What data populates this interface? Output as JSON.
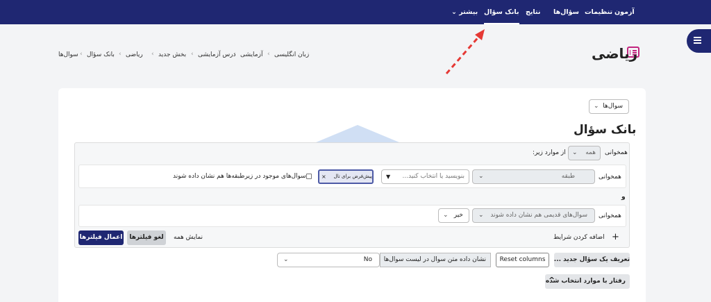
{
  "navbar": {
    "items": [
      {
        "label": "آزمون"
      },
      {
        "label": "تنظیمات"
      },
      {
        "label": "سؤال‌ها"
      },
      {
        "label": "نتایج"
      },
      {
        "label": "بانک سؤال",
        "active": true
      },
      {
        "label": "بیشتر ⌄"
      }
    ]
  },
  "breadcrumb": [
    "زبان انگلیسی",
    "آزمایشی",
    "درس آزمایشی",
    "بخش جدید",
    "ریاضی",
    "بانک سؤال",
    "سوال‌ها"
  ],
  "page": {
    "title": "ریاضی",
    "icon": "quiz-icon"
  },
  "main": {
    "section_select": "سوال‌ها",
    "heading": "بانک سؤال"
  },
  "filters": {
    "match_label": "همخوانی",
    "match_select": "همه",
    "match_suffix": "از موارد زیر:",
    "row1": {
      "match_label": "همخوانی",
      "type_select": "طبقه",
      "search_placeholder": "بنویسید یا انتخاب کنید...",
      "chip_label": "پیش‌فرض برای تال",
      "subcategory_checkbox": "سوال‌های موجود در زیرطبقه‌ها هم نشان داده شوند"
    },
    "and_label": "و",
    "row2": {
      "match_label": "همخوانی",
      "type_select": "سوال‌های قدیمی هم نشان داده شوند",
      "value_select": "خیر"
    },
    "add_condition": "اضافه کردن شرایط",
    "show_all": "نمایش همه",
    "cancel": "لغو فیلترها",
    "apply": "اعمال فیلترها"
  },
  "toolbar": {
    "new_question": "تعریف یک سؤال جدید ...",
    "reset_columns": "Reset columns",
    "show_text_label": "نشان داده متن سوال در لیست سوال‌ها",
    "show_text_value": "No",
    "bulk_action": "رفتار با موارد انتخاب شده"
  },
  "colors": {
    "navbar": "#1f2772",
    "primary": "#1f2772",
    "accent_pink": "#c2257f",
    "arrow": "#e53935"
  }
}
